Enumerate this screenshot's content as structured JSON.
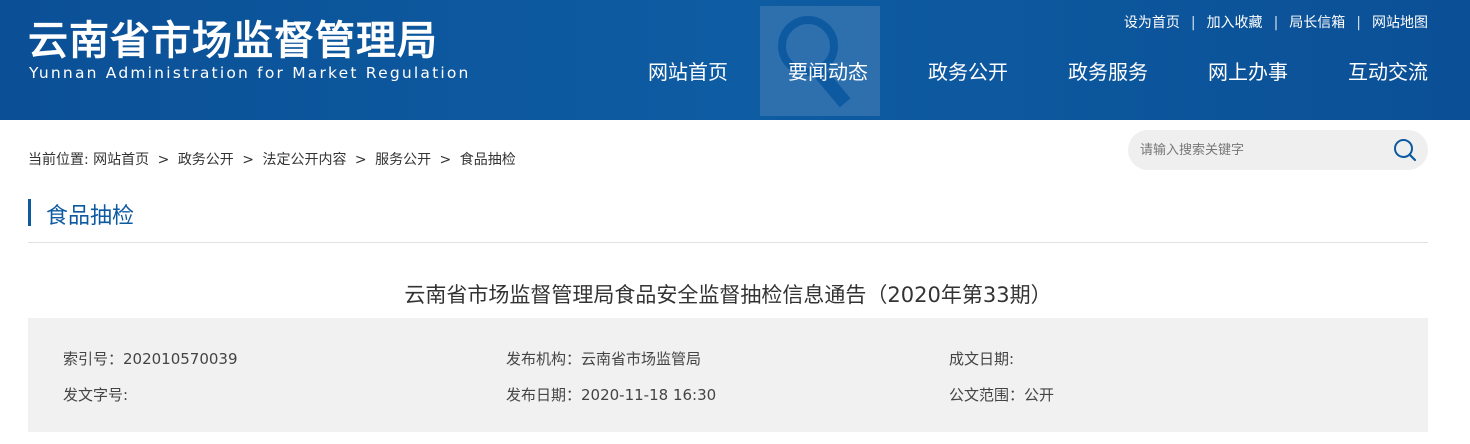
{
  "site": {
    "title_cn": "云南省市场监督管理局",
    "title_en": "Yunnan Administration for Market Regulation"
  },
  "top_links": [
    "设为首页",
    "加入收藏",
    "局长信箱",
    "网站地图"
  ],
  "nav": [
    "网站首页",
    "要闻动态",
    "政务公开",
    "政务服务",
    "网上办事",
    "互动交流"
  ],
  "breadcrumb": {
    "prefix": "当前位置:",
    "items": [
      "网站首页",
      "政务公开",
      "法定公开内容",
      "服务公开",
      "食品抽检"
    ],
    "separator": ">"
  },
  "search": {
    "placeholder": "请输入搜索关键字",
    "icon": "search-icon"
  },
  "section": {
    "title": "食品抽检"
  },
  "article": {
    "title": "云南省市场监督管理局食品安全监督抽检信息通告（2020年第33期）",
    "meta": {
      "index_no": "索引号：202010570039",
      "publisher": "发布机构：云南省市场监管局",
      "written_date": "成文日期:",
      "doc_no": "发文字号:",
      "publish_date": "发布日期：2020-11-18 16:30",
      "scope": "公文范围：公开"
    }
  },
  "colors": {
    "header_bg": "#0d5aa1",
    "accent": "#0d5aa1",
    "meta_bg": "#f1f1f1"
  }
}
